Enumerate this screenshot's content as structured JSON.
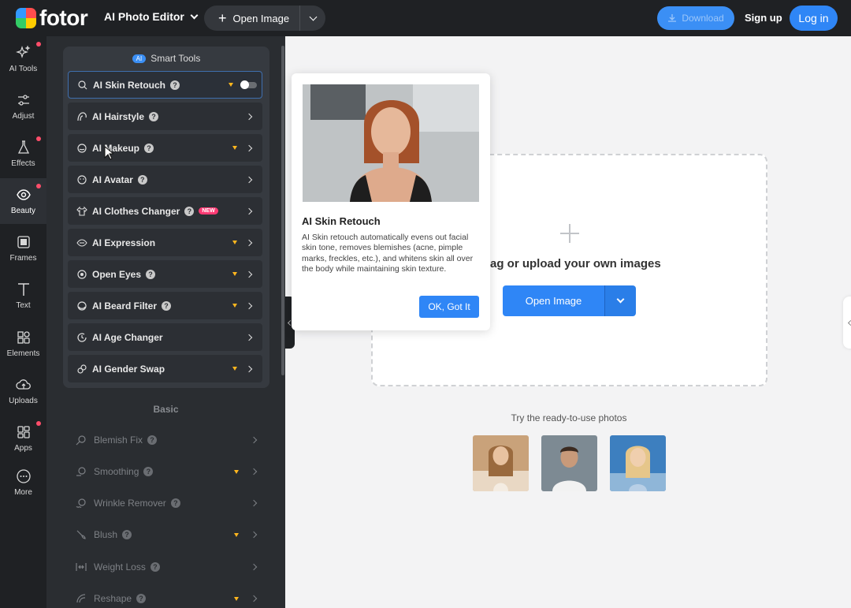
{
  "header": {
    "logo_text": "fotor",
    "editor_menu": "AI Photo Editor",
    "open_image": "Open Image",
    "download": "Download",
    "sign_up": "Sign up",
    "log_in": "Log in"
  },
  "rail": [
    {
      "label": "AI Tools",
      "icon": "sparkle-icon",
      "dot": true
    },
    {
      "label": "Adjust",
      "icon": "sliders-icon",
      "dot": false
    },
    {
      "label": "Effects",
      "icon": "flask-icon",
      "dot": true
    },
    {
      "label": "Beauty",
      "icon": "eye-icon",
      "dot": true
    },
    {
      "label": "Frames",
      "icon": "frame-icon",
      "dot": false
    },
    {
      "label": "Text",
      "icon": "text-icon",
      "dot": false
    },
    {
      "label": "Elements",
      "icon": "shapes-icon",
      "dot": false
    },
    {
      "label": "Uploads",
      "icon": "cloud-upload-icon",
      "dot": false
    },
    {
      "label": "Apps",
      "icon": "apps-icon",
      "dot": true
    },
    {
      "label": "More",
      "icon": "more-icon",
      "dot": false
    }
  ],
  "smart_tools": {
    "badge": "AI",
    "title": "Smart Tools",
    "items": [
      {
        "label": "AI Skin Retouch",
        "help": true,
        "premium": true,
        "toggle": true
      },
      {
        "label": "AI Hairstyle",
        "help": true,
        "premium": false
      },
      {
        "label": "AI Makeup",
        "help": true,
        "premium": true
      },
      {
        "label": "AI Avatar",
        "help": true,
        "premium": false
      },
      {
        "label": "AI Clothes Changer",
        "help": true,
        "premium": false,
        "new": "NEW"
      },
      {
        "label": "AI Expression",
        "help": false,
        "premium": true
      },
      {
        "label": "Open Eyes",
        "help": true,
        "premium": true
      },
      {
        "label": "AI Beard Filter",
        "help": true,
        "premium": true
      },
      {
        "label": "AI Age Changer",
        "help": false,
        "premium": false
      },
      {
        "label": "AI Gender Swap",
        "help": false,
        "premium": true
      }
    ]
  },
  "basic": {
    "title": "Basic",
    "items": [
      {
        "label": "Blemish Fix",
        "help": true,
        "premium": false
      },
      {
        "label": "Smoothing",
        "help": true,
        "premium": true
      },
      {
        "label": "Wrinkle Remover",
        "help": true,
        "premium": false
      },
      {
        "label": "Blush",
        "help": true,
        "premium": true
      },
      {
        "label": "Weight Loss",
        "help": true,
        "premium": false
      },
      {
        "label": "Reshape",
        "help": true,
        "premium": true
      }
    ]
  },
  "popover": {
    "title": "AI Skin Retouch",
    "description": "AI Skin retouch automatically evens out facial skin tone, removes blemishes (acne, pimple marks, freckles, etc.), and whitens skin all over the body while maintaining skin texture.",
    "button": "OK, Got It"
  },
  "canvas": {
    "drop_text": "Drag or upload your own images",
    "open_image": "Open Image",
    "try_text": "Try the ready-to-use photos"
  },
  "colors": {
    "accent": "#2f86f6",
    "dark_bg": "#1f2124",
    "panel_bg": "#2a2d31",
    "badge_new": "#ff3b74",
    "premium": "#ffb61e"
  }
}
